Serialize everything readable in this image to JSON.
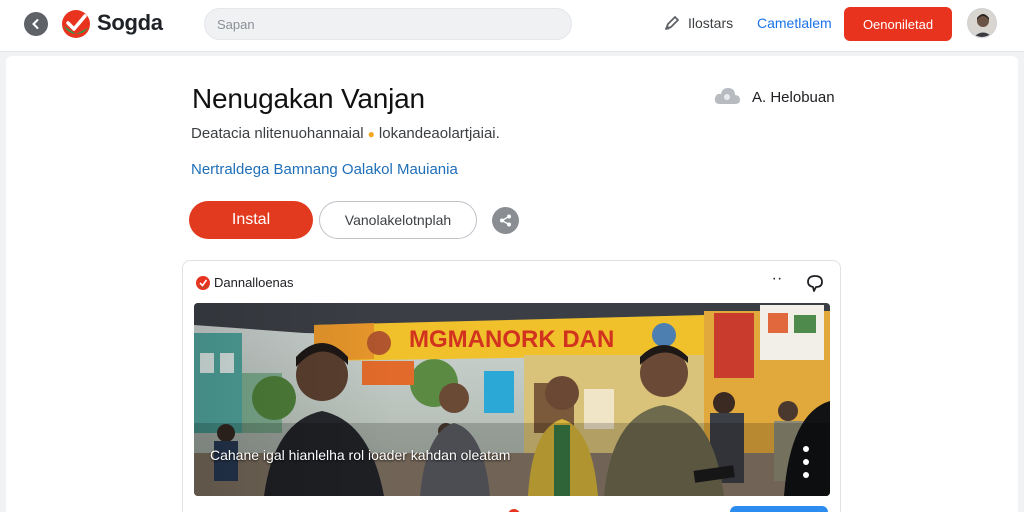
{
  "header": {
    "logo_text": "Sogda",
    "search_placeholder": "Sapan",
    "nav_link_1": "Ilostars",
    "nav_link_2": "Cametlalem",
    "cta_label": "Oenoniletad"
  },
  "page": {
    "title": "Nenugakan Vanjan",
    "follow_label": "A. Helobuan",
    "subtitle_part1": "Deatacia nlitenuohannaial",
    "subtitle_part2": "lokandeaolartjaiai.",
    "meta_link": "Nertraldega Bamnang Oalakol Mauiania",
    "install_label": "Instal",
    "secondary_label": "Vanolakelotnplah"
  },
  "card": {
    "header_title": "Dannalloenas",
    "banner_text": "MGMANORK DAN",
    "caption": "Cahane igal hianlelha rol ioader kahdan oleatam"
  },
  "colors": {
    "brand_red": "#e8341f",
    "link_blue": "#1a73e8",
    "icon_gray": "#5f6368"
  },
  "icons": {
    "back": "chevron-left-icon",
    "logo": "checkmark-logo-icon",
    "nav": "pen-icon",
    "follow": "cloud-icon",
    "share": "share-icon",
    "card_head": "app-badge-icon",
    "more": "more-dots-icon",
    "comment": "comment-bubble-icon"
  }
}
